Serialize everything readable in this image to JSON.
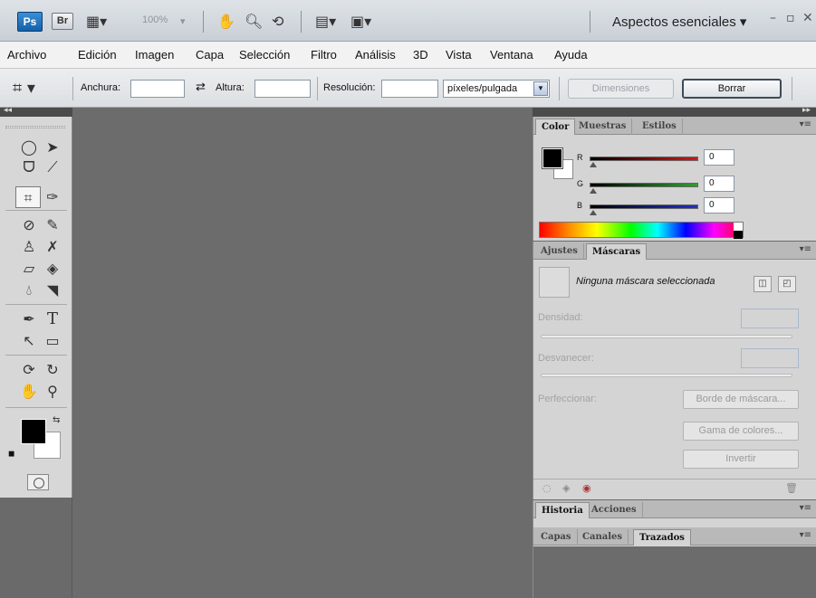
{
  "titlebar": {
    "ps_label": "Ps",
    "br_label": "Br",
    "zoom": "100%",
    "workspace": "Aspectos esenciales ▾"
  },
  "menu": [
    "Archivo",
    "Edición",
    "Imagen",
    "Capa",
    "Selección",
    "Filtro",
    "Análisis",
    "3D",
    "Vista",
    "Ventana",
    "Ayuda"
  ],
  "options": {
    "width_label": "Anchura:",
    "height_label": "Altura:",
    "resolution_label": "Resolución:",
    "width_value": "",
    "height_value": "",
    "resolution_value": "",
    "unit_selected": "píxeles/pulgada",
    "front_image_button": "Dimensiones",
    "clear_button": "Borrar"
  },
  "color_panel": {
    "tabs": [
      "Color",
      "Muestras",
      "Estilos"
    ],
    "active_tab": "Color",
    "channels": [
      {
        "name": "R",
        "value": "0",
        "color": "#d01818"
      },
      {
        "name": "G",
        "value": "0",
        "color": "#2ea02e"
      },
      {
        "name": "B",
        "value": "0",
        "color": "#2030c8"
      }
    ],
    "foreground": "#000000",
    "background": "#ffffff"
  },
  "masks_panel": {
    "tabs": [
      "Ajustes",
      "Máscaras"
    ],
    "active_tab": "Máscaras",
    "title": "Ninguna máscara seleccionada",
    "density_label": "Densidad:",
    "feather_label": "Desvanecer:",
    "refine_label": "Perfeccionar:",
    "mask_edge_button": "Borde de máscara...",
    "color_range_button": "Gama de colores...",
    "invert_button": "Invertir"
  },
  "history_panel": {
    "tabs": [
      "Historia",
      "Acciones"
    ],
    "active_tab": "Historia"
  },
  "layers_panel": {
    "tabs": [
      "Capas",
      "Canales",
      "Trazados"
    ],
    "active_tab": "Trazados"
  }
}
